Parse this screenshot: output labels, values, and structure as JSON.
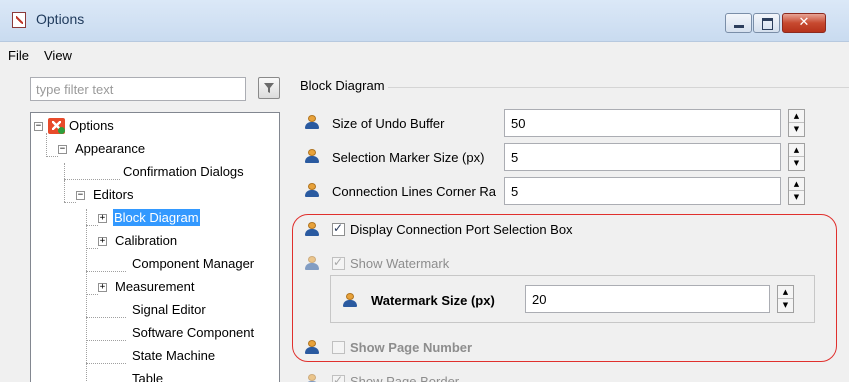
{
  "window": {
    "title": "Options",
    "close_glyph": "✕"
  },
  "menu": {
    "items": [
      "File",
      "View"
    ]
  },
  "filter": {
    "placeholder": "type filter text",
    "value": ""
  },
  "tree": {
    "root": "Options",
    "appearance": "Appearance",
    "confirmation_dialogs": "Confirmation Dialogs",
    "editors": "Editors",
    "block_diagram": "Block Diagram",
    "calibration": "Calibration",
    "component_manager": "Component Manager",
    "measurement": "Measurement",
    "signal_editor": "Signal Editor",
    "software_component": "Software Component",
    "state_machine": "State Machine",
    "table": "Table",
    "expanded_glyph": "−",
    "collapsed_glyph": "+"
  },
  "panel": {
    "group_title": "Block Diagram",
    "undo_buffer_label": "Size of Undo Buffer",
    "undo_buffer_value": "50",
    "selection_marker_label": "Selection Marker Size (px)",
    "selection_marker_value": "5",
    "corner_radius_label": "Connection Lines Corner Ra",
    "corner_radius_value": "5",
    "display_port_selection_label": "Display Connection Port Selection Box",
    "display_port_selection_checked": true,
    "show_watermark_label": "Show Watermark",
    "show_watermark_checked": true,
    "watermark_size_label": "Watermark Size (px)",
    "watermark_size_value": "20",
    "show_page_number_label": "Show Page Number",
    "show_page_number_checked": false,
    "show_page_border_label": "Show Page Border",
    "spin_up": "▲",
    "spin_down": "▼"
  },
  "colors": {
    "highlight": "#e0302d",
    "selection": "#3399ff"
  }
}
